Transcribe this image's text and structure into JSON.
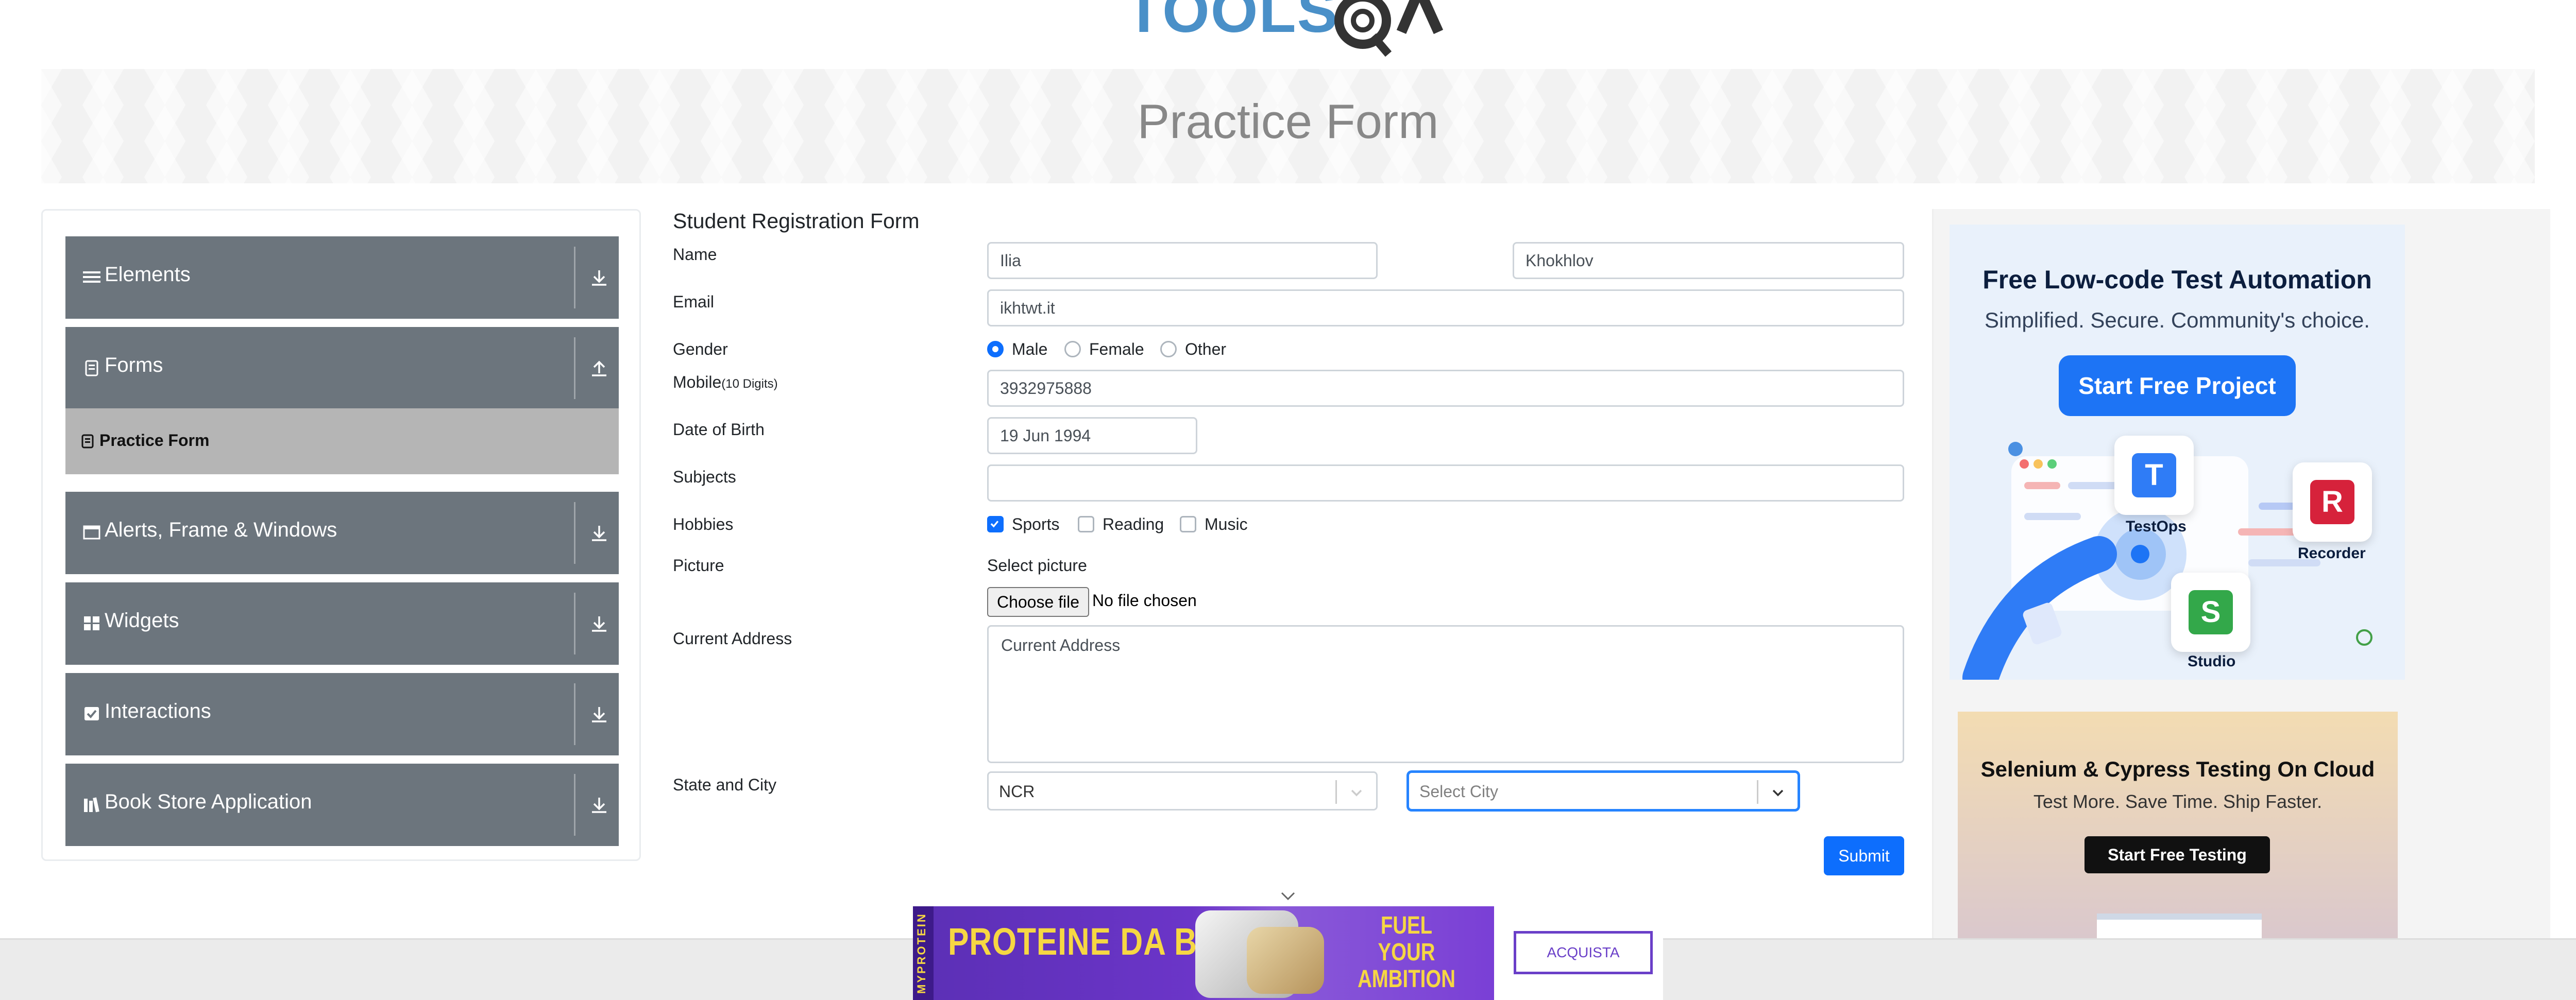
{
  "logo": {
    "text": "TOOLSQA"
  },
  "banner": {
    "title": "Practice Form"
  },
  "sidebar": {
    "groups": [
      {
        "label": "Elements",
        "icon": "list-icon",
        "expanded": false
      },
      {
        "label": "Forms",
        "icon": "document-icon",
        "expanded": true
      },
      {
        "label": "Alerts, Frame & Windows",
        "icon": "window-icon",
        "expanded": false
      },
      {
        "label": "Widgets",
        "icon": "grid-icon",
        "expanded": false
      },
      {
        "label": "Interactions",
        "icon": "checkbox-icon",
        "expanded": false
      },
      {
        "label": "Book Store Application",
        "icon": "books-icon",
        "expanded": false
      }
    ],
    "active_item": {
      "label": "Practice Form",
      "icon": "document-icon"
    }
  },
  "form": {
    "title": "Student Registration Form",
    "labels": {
      "name": "Name",
      "email": "Email",
      "gender": "Gender",
      "mobile": "Mobile",
      "mobile_hint": "(10 Digits)",
      "dob": "Date of Birth",
      "subjects": "Subjects",
      "hobbies": "Hobbies",
      "picture": "Picture",
      "address": "Current Address",
      "state_city": "State and City"
    },
    "first_name": "Ilia",
    "last_name": "Khokhlov",
    "email": "ikhtwt.it",
    "gender_options": [
      {
        "label": "Male",
        "selected": true
      },
      {
        "label": "Female",
        "selected": false
      },
      {
        "label": "Other",
        "selected": false
      }
    ],
    "mobile": "3932975888",
    "dob": "19 Jun 1994",
    "subjects": "",
    "hobbies": [
      {
        "label": "Sports",
        "checked": true
      },
      {
        "label": "Reading",
        "checked": false
      },
      {
        "label": "Music",
        "checked": false
      }
    ],
    "picture_prompt": "Select picture",
    "choose_file": "Choose file",
    "no_file": "No file chosen",
    "address_placeholder": "Current Address",
    "state": "NCR",
    "city_placeholder": "Select City",
    "submit": "Submit"
  },
  "ads": {
    "katalon": {
      "title": "Free Low-code Test Automation",
      "subtitle": "Simplified. Secure. Community's choice.",
      "button": "Start Free Project",
      "tiles": [
        {
          "letter": "T",
          "label": "TestOps",
          "color": "#2f7cf6"
        },
        {
          "letter": "R",
          "label": "Recorder",
          "color": "#d6223b"
        },
        {
          "letter": "S",
          "label": "Studio",
          "color": "#33a84a"
        }
      ]
    },
    "cloud": {
      "title": "Selenium & Cypress Testing On Cloud",
      "subtitle": "Test More. Save Time. Ship Faster.",
      "button": "Start Free Testing"
    },
    "protein": {
      "brand": "MYPROTEIN",
      "headline": "PROTEINE DA BERE",
      "tagline": [
        "FUEL",
        "YOUR",
        "AMBITION"
      ],
      "button": "ACQUISTA"
    }
  },
  "colors": {
    "primary": "#0d6efd",
    "sidebar_group": "#6c757d",
    "sidebar_active": "#b5b5b5"
  }
}
